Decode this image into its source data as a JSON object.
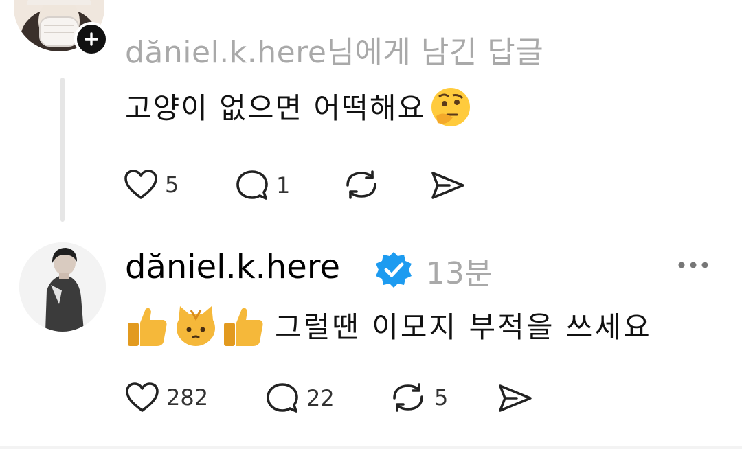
{
  "reply": {
    "reply_to_user": "dăniel.k.here",
    "reply_to_suffix": "님에게 남긴 답글",
    "text": "고양이 없으면 어떡해요",
    "likes": "5",
    "comments": "1"
  },
  "post": {
    "username": "dăniel.k.here",
    "time": "13분",
    "text": "그럴땐 이모지 부적을 쓰세요",
    "likes": "282",
    "comments": "22",
    "reposts": "5"
  },
  "icons": {
    "like": "heart-icon",
    "comment": "comment-icon",
    "repost": "repost-icon",
    "share": "send-icon",
    "verified": "verified-badge-icon",
    "more": "more-icon",
    "follow": "plus-icon"
  },
  "colors": {
    "accent": "#1d9bf0",
    "secondary_text": "#a9a9a9"
  }
}
